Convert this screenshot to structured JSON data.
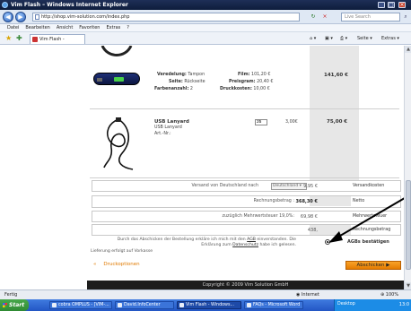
{
  "window": {
    "title": "Vim Flash – Windows Internet Explorer",
    "minimize": "_",
    "maximize": "□",
    "close": "×"
  },
  "address_bar": {
    "back": "◀",
    "forward": "▶",
    "url": "http://shop.vim-solution.com/index.php",
    "refresh": "↻",
    "stop": "×",
    "search_placeholder": "Live Search",
    "search_go": "⌕"
  },
  "menu": [
    "Datei",
    "Bearbeiten",
    "Ansicht",
    "Favoriten",
    "Extras",
    "?"
  ],
  "favorites_bar": {
    "tab_label": "Vim Flash -",
    "tools": [
      "⌂ ▾",
      "▣ ▾",
      "⎙ ▾",
      "Seite ▾",
      "Extras ▾"
    ]
  },
  "products": [
    {
      "left_labels": [
        {
          "label": "Veredelung:",
          "value": "Tampon"
        },
        {
          "label": "Seite:",
          "value": "Rückseite"
        },
        {
          "label": "Farbenanzahl:",
          "value": "2"
        }
      ],
      "right_labels": [
        {
          "label": "Film:",
          "value": "101,20 €"
        },
        {
          "label": "Preisgram:",
          "value": "20,40 €"
        },
        {
          "label": "Druckkosten:",
          "value": "10,00 €"
        }
      ],
      "line_total": "141,60 €"
    },
    {
      "name": "USB Lanyard",
      "subtitle": "USB Lanyard",
      "art_nr": "Art.-Nr.:",
      "quantity": "25",
      "unit_price": "3,00€",
      "line_total": "75,00 €"
    }
  ],
  "summary": {
    "shipping_label": "Versand von Deutschland nach",
    "shipping_country": "Deutschland",
    "shipping_value": "9,95 €",
    "shipping_tag": "Versandkosten",
    "invoice_label": "Rechnungsbetrag :",
    "invoice_value": "368,30 €",
    "invoice_tag": "Netto",
    "vat_label": "zuzüglich Mehrwertsteuer 19,0%:",
    "vat_value": "69,98 €",
    "vat_tag": "Mehrwertsteuer",
    "gross_value": "438,",
    "gross_tag": "Rechnungsbetrag"
  },
  "agb": {
    "text_pre": "Durch das Abschicken der Bestellung erkläre ich mich mit den ",
    "agb_link": "AGB",
    "text_mid": " einverstanden. Die Erklärung zum ",
    "privacy_link": "Datenschutz",
    "text_post": " habe ich gelesen.",
    "label": "AGBs bestätigen",
    "delivery_note": "Lieferung erfolgt auf Vorkasse"
  },
  "actions": {
    "back_chevron": "«",
    "back_label": "Druckoptionen",
    "order_label": "Abschicken ▶"
  },
  "footer": {
    "copyright": "Copyright © 2009 Vim Solution GmbH"
  },
  "status_bar": {
    "status": "Fertig",
    "zone": "Internet",
    "zoom": "100%"
  },
  "taskbar": {
    "start": "Start",
    "tasks": [
      "cobra OMPLUS - [VIM-...",
      "David.InfoCenter",
      "Vim Flash - Windows...",
      "FAQs - Microsoft Word"
    ],
    "desktop": "Desktop",
    "clock": "13:0"
  },
  "colors": {
    "accent_orange": "#e57c00",
    "link_orange": "#e07a00",
    "footer_dark": "#1d1d1d",
    "price_panel": "#e7e7e7"
  }
}
